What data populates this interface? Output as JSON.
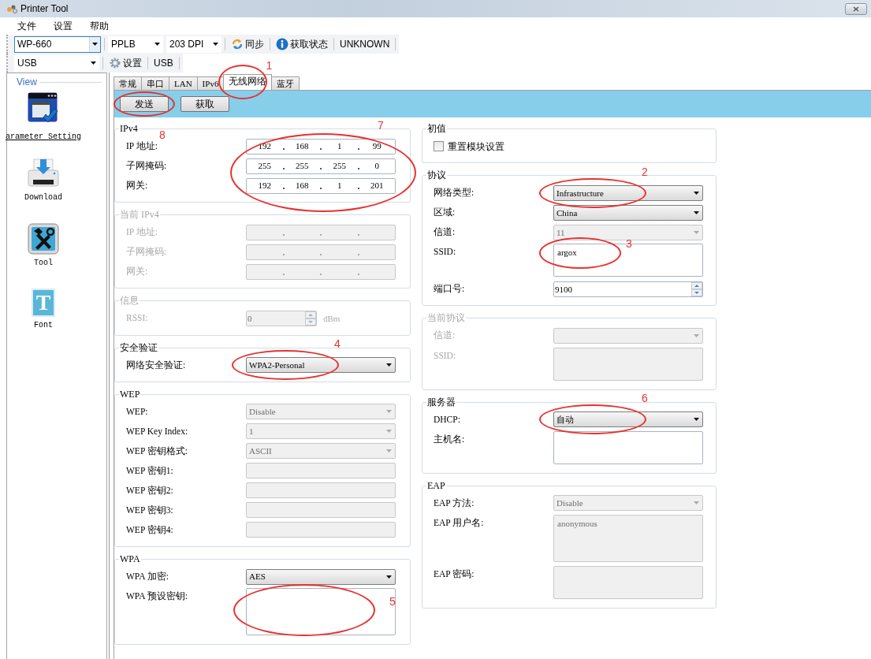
{
  "window": {
    "title": "Printer Tool"
  },
  "menu": [
    "文件",
    "设置",
    "帮助"
  ],
  "toolbar": [
    {
      "kind": "combo",
      "value": "WP-660",
      "focused": true
    },
    {
      "kind": "select",
      "value": "PPLB"
    },
    {
      "kind": "select",
      "value": "203 DPI"
    },
    {
      "kind": "sync",
      "label": "同步"
    },
    {
      "kind": "status",
      "label": "获取状态"
    },
    {
      "kind": "label",
      "label": "UNKNOWN"
    }
  ],
  "toolbar_2": [
    {
      "kind": "select",
      "value": "USB"
    },
    {
      "kind": "settings",
      "label": "设置"
    },
    {
      "kind": "label",
      "label": "USB"
    }
  ],
  "sidebar": {
    "title": "View",
    "items": [
      {
        "label": "arameter Setting",
        "selected": true
      },
      {
        "label": "Download",
        "selected": false
      },
      {
        "label": "Tool",
        "selected": false
      },
      {
        "label": "Font",
        "selected": false,
        "glyph": "T"
      }
    ]
  },
  "tabs": [
    {
      "label": "常规",
      "selected": false
    },
    {
      "label": "串口",
      "selected": false
    },
    {
      "label": "LAN",
      "selected": false
    },
    {
      "label": "IPv6",
      "selected": false
    },
    {
      "label": "无线网络",
      "selected": true,
      "circled": true,
      "callout": "1"
    },
    {
      "label": "蓝牙",
      "selected": false
    }
  ],
  "actions": [
    {
      "label": "发送",
      "circled": true
    },
    {
      "label": "获取",
      "circled": false
    }
  ],
  "columns": [
    [
      {
        "title": "IPv4",
        "disabled": false,
        "title_callout": "8",
        "circled": true,
        "callout": "7",
        "fields": [
          {
            "label": "IP 地址:",
            "kind": "ip",
            "disabled": false,
            "octets": [
              "192",
              "168",
              "1",
              "99"
            ]
          },
          {
            "label": "子网掩码:",
            "kind": "ip",
            "disabled": false,
            "octets": [
              "255",
              "255",
              "255",
              "0"
            ]
          },
          {
            "label": "网关:",
            "kind": "ip",
            "disabled": false,
            "octets": [
              "192",
              "168",
              "1",
              "201"
            ]
          }
        ]
      },
      {
        "title": "当前 IPv4",
        "disabled": true,
        "fields": [
          {
            "label": "IP 地址:",
            "kind": "ip",
            "disabled": true
          },
          {
            "label": "子网掩码:",
            "kind": "ip",
            "disabled": true
          },
          {
            "label": "网关:",
            "kind": "ip",
            "disabled": true
          }
        ]
      },
      {
        "title": "信息",
        "disabled": true,
        "fields": [
          {
            "label": "RSSI:",
            "kind": "spin",
            "disabled": true,
            "value": "0",
            "unit": "dBm"
          }
        ]
      },
      {
        "title": "安全验证",
        "disabled": false,
        "fields": [
          {
            "label": "网络安全验证:",
            "kind": "select",
            "disabled": false,
            "value": "WPA2-Personal",
            "circled": true,
            "callout": "4"
          }
        ]
      },
      {
        "title": "WEP",
        "disabled": false,
        "fields": [
          {
            "label": "WEP:",
            "kind": "select",
            "disabled": true,
            "value": "Disable"
          },
          {
            "label": "WEP Key Index:",
            "kind": "select",
            "disabled": true,
            "value": "1"
          },
          {
            "label": "WEP 密钥格式:",
            "kind": "select",
            "disabled": true,
            "value": "ASCII"
          },
          {
            "label": "WEP 密钥1:",
            "kind": "text",
            "disabled": true
          },
          {
            "label": "WEP 密钥2:",
            "kind": "text",
            "disabled": true
          },
          {
            "label": "WEP 密钥3:",
            "kind": "text",
            "disabled": true
          },
          {
            "label": "WEP 密钥4:",
            "kind": "text",
            "disabled": true
          }
        ]
      },
      {
        "title": "WPA",
        "disabled": false,
        "fields": [
          {
            "label": "WPA 加密:",
            "kind": "select",
            "disabled": false,
            "value": "AES"
          },
          {
            "label": "WPA 预设密钥:",
            "kind": "memo",
            "disabled": false,
            "circled": true,
            "callout": "5"
          }
        ]
      }
    ],
    [
      {
        "title": "初值",
        "disabled": false,
        "fields": [
          {
            "label": "重置模块设置",
            "kind": "checkbox",
            "disabled": false,
            "checked": false
          }
        ]
      },
      {
        "title": "协议",
        "disabled": false,
        "fields": [
          {
            "label": "网络类型:",
            "kind": "select",
            "disabled": false,
            "value": "Infrastructure",
            "circled": true,
            "callout": "2"
          },
          {
            "label": "区域:",
            "kind": "select",
            "disabled": false,
            "value": "China"
          },
          {
            "label": "信道:",
            "kind": "select",
            "disabled": true,
            "value": "11"
          },
          {
            "label": "SSID:",
            "kind": "textarea",
            "disabled": false,
            "value": "argox",
            "circled": true,
            "callout": "3"
          },
          {
            "label": "端口号:",
            "kind": "spin",
            "disabled": false,
            "value": "9100"
          }
        ]
      },
      {
        "title": "当前协议",
        "disabled": true,
        "fields": [
          {
            "label": "信道:",
            "kind": "select",
            "disabled": true
          },
          {
            "label": "SSID:",
            "kind": "textarea",
            "disabled": true
          }
        ]
      },
      {
        "title": "服务器",
        "disabled": false,
        "fields": [
          {
            "label": "DHCP:",
            "kind": "select",
            "disabled": false,
            "value": "自动",
            "circled": true,
            "callout": "6"
          },
          {
            "label": "主机名:",
            "kind": "textarea",
            "disabled": false
          }
        ]
      },
      {
        "title": "EAP",
        "disabled": false,
        "fields": [
          {
            "label": "EAP 方法:",
            "kind": "select",
            "disabled": true,
            "value": "Disable"
          },
          {
            "label": "EAP 用户名:",
            "kind": "memo",
            "disabled": true,
            "value": "anonymous"
          },
          {
            "label": "EAP 密码:",
            "kind": "textarea",
            "disabled": true
          }
        ]
      }
    ]
  ]
}
